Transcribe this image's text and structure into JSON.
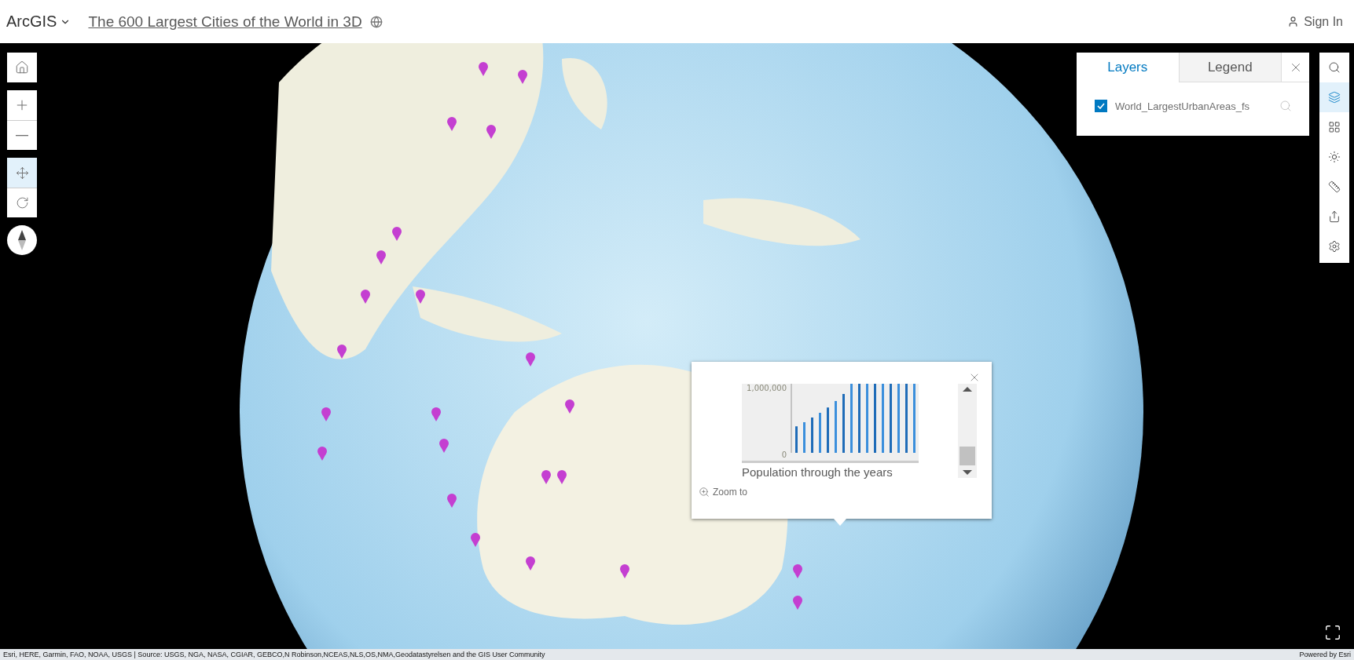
{
  "header": {
    "app_menu": "ArcGIS",
    "title": "The 600 Largest Cities of the World in 3D",
    "sign_in": "Sign In"
  },
  "zoom_tools": [
    {
      "kind": "home"
    },
    {
      "kind": "zoomin"
    },
    {
      "kind": "zoomout"
    }
  ],
  "navigation_modes": [
    {
      "kind": "pan",
      "selected": true
    },
    {
      "kind": "rotate",
      "selected": false
    }
  ],
  "widgets": [
    {
      "kind": "search",
      "selected": false
    },
    {
      "kind": "layers",
      "selected": true
    },
    {
      "kind": "basemap",
      "selected": false
    },
    {
      "kind": "daylight",
      "selected": false
    },
    {
      "kind": "measure",
      "selected": false
    },
    {
      "kind": "share",
      "selected": false
    },
    {
      "kind": "settings",
      "selected": false
    }
  ],
  "layers_panel": {
    "tabs": [
      {
        "label": "Layers",
        "selected": true
      },
      {
        "label": "Legend",
        "selected": false
      }
    ],
    "layers": [
      {
        "name": "World_LargestUrbanAreas_fs",
        "checked": true
      }
    ]
  },
  "popup": {
    "axis_labels": [
      "1,000,000",
      "0"
    ],
    "chart_caption": "Population through the years",
    "action": "Zoom to"
  },
  "attribution": {
    "sources": "Esri, HERE, Garmin, FAO, NOAA, USGS | Source: USGS, NGA, NASA, CGIAR, GEBCO,N Robinson,NCEAS,NLS,OS,NMA,Geodatastyrelsen and the GIS User Community",
    "powered_by": "Powered by Esri"
  }
}
